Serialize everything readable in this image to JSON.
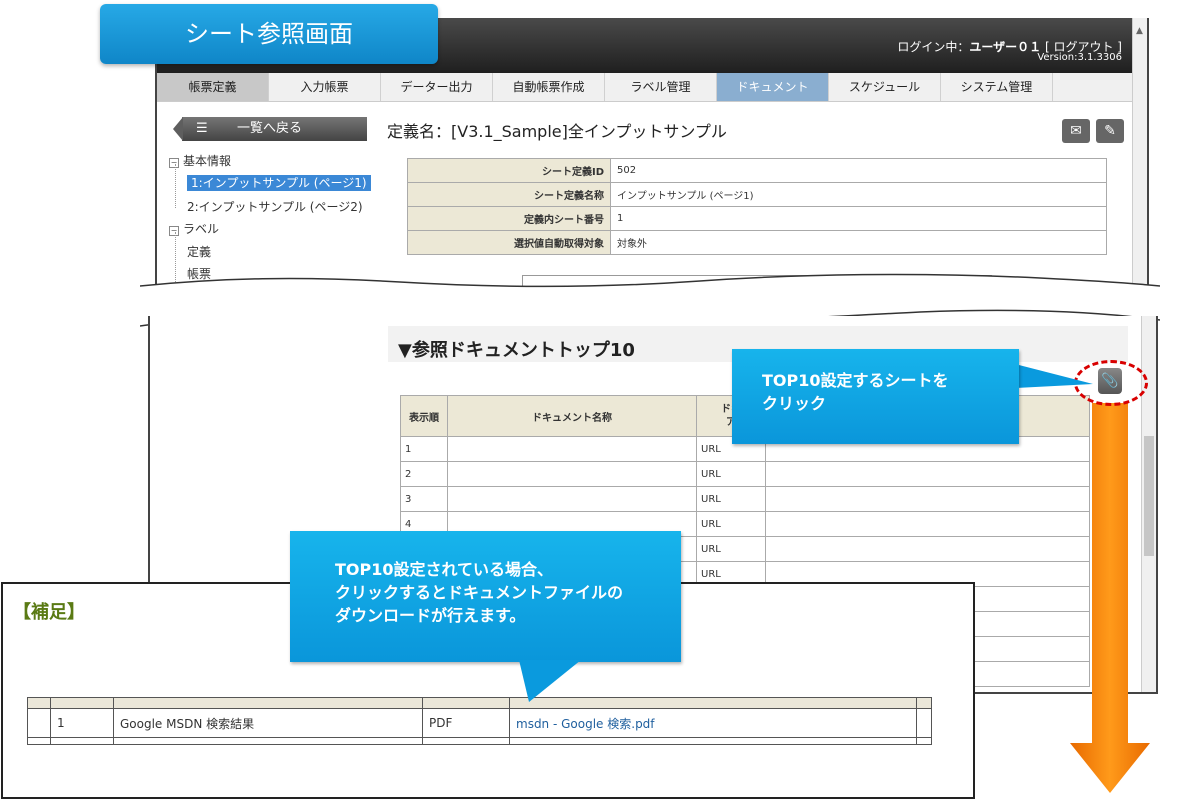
{
  "title_badge": "シート参照画面",
  "header": {
    "login_prefix": "ログイン中：",
    "user": "ユーザー０１",
    "logout": "[ ログアウト ]",
    "version": "Version:3.1.3306"
  },
  "nav_tabs": [
    "帳票定義",
    "入力帳票",
    "データー出力",
    "自動帳票作成",
    "ラベル管理",
    "ドキュメント",
    "スケジュール",
    "システム管理"
  ],
  "back_button": "一覧へ戻る",
  "definition_name": "定義名：[V3.1_Sample]全インプットサンプル",
  "tree": {
    "basic_info": "基本情報",
    "page1": "1:インプットサンプル (ページ1)",
    "page2": "2:インプットサンプル (ページ2)",
    "label": "ラベル",
    "definition": "定義",
    "form": "帳票"
  },
  "info_rows": [
    {
      "label": "シート定義ID",
      "value": "502"
    },
    {
      "label": "シート定義名称",
      "value": "インプットサンプル (ページ1)"
    },
    {
      "label": "定義内シート番号",
      "value": "1"
    },
    {
      "label": "選択値自動取得対象",
      "value": "対象外"
    }
  ],
  "section_title": "▼参照ドキュメントトップ10",
  "ref_table": {
    "headers": [
      "表示順",
      "ドキュメント名称",
      "ドキ\nア"
    ],
    "rows": [
      {
        "no": "1",
        "type": "URL"
      },
      {
        "no": "2",
        "type": "URL"
      },
      {
        "no": "3",
        "type": "URL"
      },
      {
        "no": "4",
        "type": "URL"
      },
      {
        "no": "",
        "type": "URL"
      },
      {
        "no": "",
        "type": "URL"
      }
    ]
  },
  "callout1": [
    "TOP10設定するシートを",
    "クリック"
  ],
  "callout2": [
    "TOP10設定されている場合、",
    "クリックするとドキュメントファイルの",
    "ダウンロードが行えます。"
  ],
  "supplement": {
    "title": "【補足】",
    "row": {
      "no": "1",
      "name": "Google MSDN 検索結果",
      "type": "PDF",
      "file": "msdn - Google 検索.pdf"
    }
  },
  "colors": {
    "callout": "#0a96da",
    "accent_orange": "#f07d00",
    "ring_red": "#d80000",
    "supp_title": "#5a7a14"
  }
}
